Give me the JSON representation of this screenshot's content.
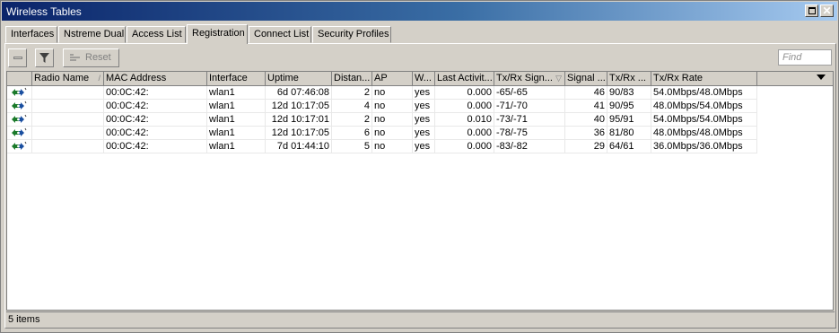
{
  "window": {
    "title": "Wireless Tables"
  },
  "tabs": [
    {
      "label": "Interfaces",
      "active": false
    },
    {
      "label": "Nstreme Dual",
      "active": false
    },
    {
      "label": "Access List",
      "active": false
    },
    {
      "label": "Registration",
      "active": true
    },
    {
      "label": "Connect List",
      "active": false
    },
    {
      "label": "Security Profiles",
      "active": false
    }
  ],
  "toolbar": {
    "reset_label": "Reset",
    "find_placeholder": "Find"
  },
  "table": {
    "columns": [
      "Radio Name",
      "MAC Address",
      "Interface",
      "Uptime",
      "Distan...",
      "AP",
      "W...",
      "Last Activit...",
      "Tx/Rx Sign...",
      "Signal ...",
      "Tx/Rx ...",
      "Tx/Rx Rate"
    ],
    "rows": [
      {
        "icon": "wireless-station-icon",
        "radio_name": "",
        "mac": "00:0C:42:",
        "interface": "wlan1",
        "uptime": "6d 07:46:08",
        "distance": "2",
        "ap": "no",
        "wds": "yes",
        "last_activity": "0.000",
        "txrx_signal": "-65/-65",
        "signal": "46",
        "txrx_ccq": "90/83",
        "txrx_rate": "54.0Mbps/48.0Mbps"
      },
      {
        "icon": "wireless-station-icon",
        "radio_name": "",
        "mac": "00:0C:42:",
        "interface": "wlan1",
        "uptime": "12d 10:17:05",
        "distance": "4",
        "ap": "no",
        "wds": "yes",
        "last_activity": "0.000",
        "txrx_signal": "-71/-70",
        "signal": "41",
        "txrx_ccq": "90/95",
        "txrx_rate": "48.0Mbps/54.0Mbps"
      },
      {
        "icon": "wireless-station-icon",
        "radio_name": "",
        "mac": "00:0C:42:",
        "interface": "wlan1",
        "uptime": "12d 10:17:01",
        "distance": "2",
        "ap": "no",
        "wds": "yes",
        "last_activity": "0.010",
        "txrx_signal": "-73/-71",
        "signal": "40",
        "txrx_ccq": "95/91",
        "txrx_rate": "54.0Mbps/54.0Mbps"
      },
      {
        "icon": "wireless-station-icon",
        "radio_name": "",
        "mac": "00:0C:42:",
        "interface": "wlan1",
        "uptime": "12d 10:17:05",
        "distance": "6",
        "ap": "no",
        "wds": "yes",
        "last_activity": "0.000",
        "txrx_signal": "-78/-75",
        "signal": "36",
        "txrx_ccq": "81/80",
        "txrx_rate": "48.0Mbps/48.0Mbps"
      },
      {
        "icon": "wireless-station-icon",
        "radio_name": "",
        "mac": "00:0C:42:",
        "interface": "wlan1",
        "uptime": "7d 01:44:10",
        "distance": "5",
        "ap": "no",
        "wds": "yes",
        "last_activity": "0.000",
        "txrx_signal": "-83/-82",
        "signal": "29",
        "txrx_ccq": "64/61",
        "txrx_rate": "36.0Mbps/36.0Mbps"
      }
    ]
  },
  "status": {
    "items_label": "5 items"
  }
}
